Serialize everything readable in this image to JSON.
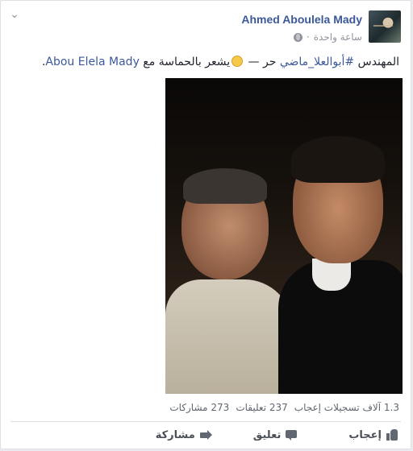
{
  "post": {
    "author": "Ahmed Aboulela Mady",
    "timestamp": "ساعة واحدة",
    "separator": "·",
    "privacy_icon": "globe-icon",
    "menu_icon": "chevron-down-icon",
    "text": {
      "prefix": "المهندس ",
      "hashtag": "#أبوالعلا_ماضي",
      "middle": " حر — ",
      "feeling": "يشعر بالحماسة مع ",
      "tagged": "Abou Elela Mady",
      "suffix": "."
    },
    "photo": {
      "description_icon": "photo"
    }
  },
  "stats": {
    "likes": "1.3 آلاف تسجيلات إعجاب",
    "comments": "237 تعليقات",
    "shares": "273 مشاركات"
  },
  "actions": {
    "like": "إعجاب",
    "comment": "تعليق",
    "share": "مشاركة"
  },
  "colors": {
    "link": "#3b5998",
    "text": "#1d2129",
    "muted": "#90949c",
    "border": "#dddfe2"
  }
}
